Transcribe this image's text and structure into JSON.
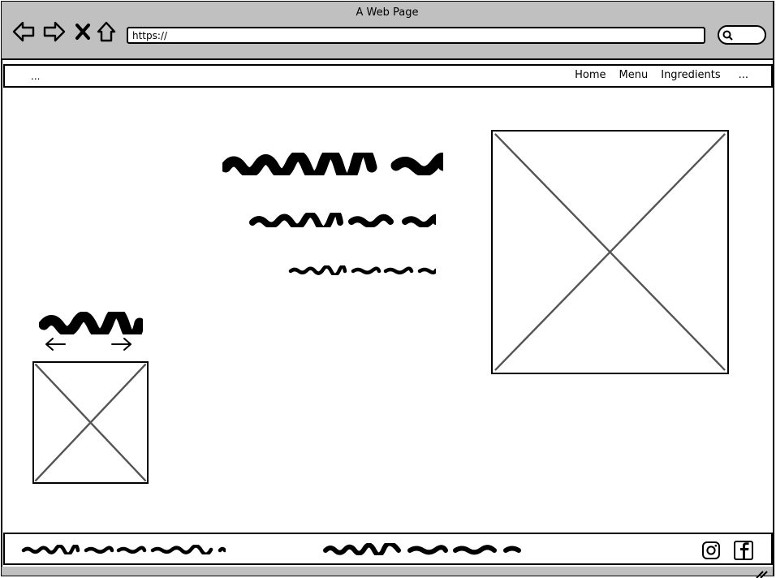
{
  "window": {
    "title": "A Web Page"
  },
  "toolbar": {
    "back_icon": "back-arrow-icon",
    "forward_icon": "forward-arrow-icon",
    "stop_icon": "close-icon",
    "home_icon": "home-icon",
    "url": "https://",
    "search_icon": "search-icon"
  },
  "site_nav": {
    "brand": "...",
    "links": [
      {
        "label": "Home"
      },
      {
        "label": "Menu"
      },
      {
        "label": "Ingredients"
      },
      {
        "label": "..."
      }
    ]
  },
  "main": {
    "heading_placeholder": "squiggle-heading",
    "subheading_placeholder": "squiggle-subheading",
    "body_placeholder": "squiggle-small-text",
    "hero_image": "image-placeholder",
    "carousel": {
      "title_placeholder": "squiggle-title",
      "prev_icon": "arrow-left-icon",
      "next_icon": "arrow-right-icon",
      "image": "image-placeholder"
    }
  },
  "footer": {
    "left_text_placeholder": "squiggle-text",
    "center_text_placeholder": "squiggle-text",
    "social": [
      {
        "name": "instagram-icon"
      },
      {
        "name": "facebook-icon"
      }
    ]
  },
  "colors": {
    "chrome": "#c0c0c0",
    "ink": "#000000",
    "placeholder_line": "#555555",
    "background": "#ffffff"
  }
}
